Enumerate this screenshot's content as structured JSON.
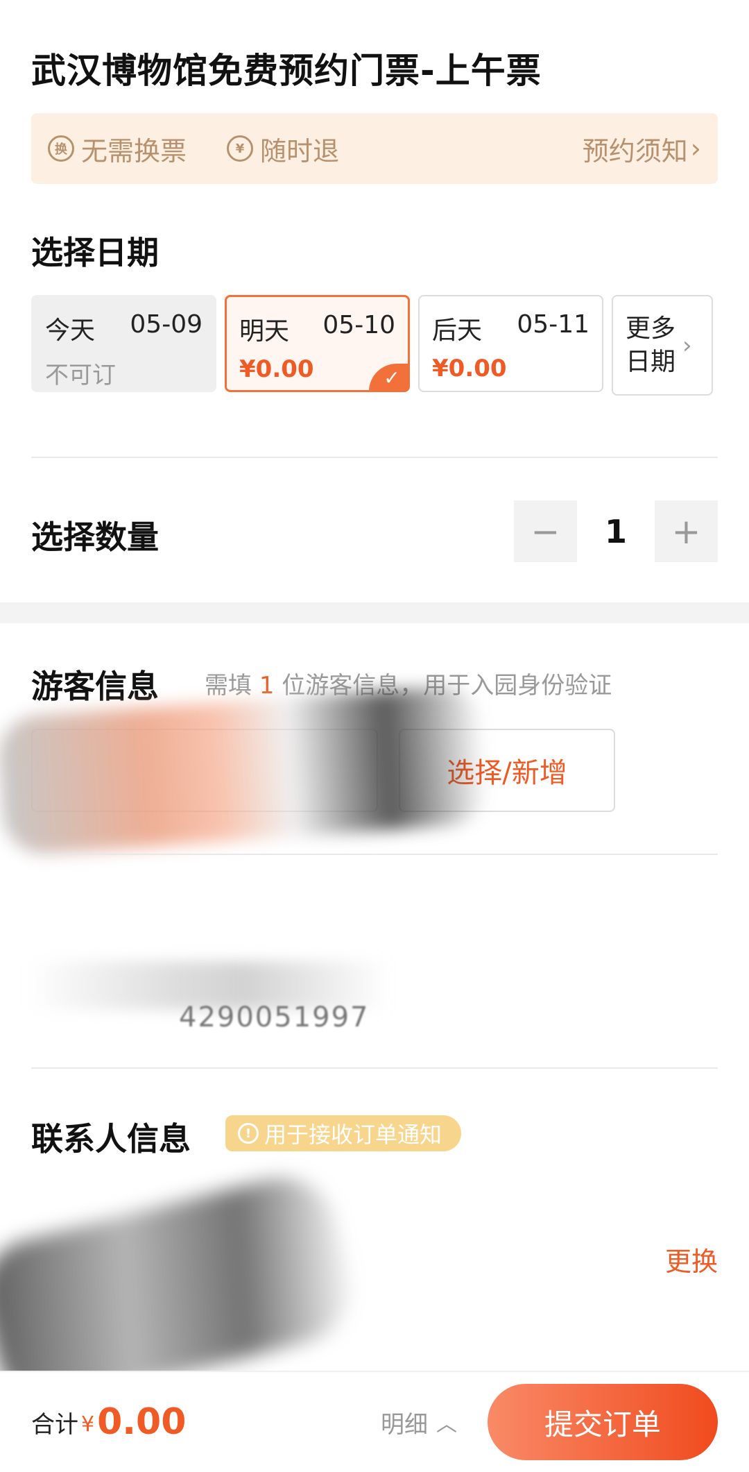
{
  "page": {
    "title": "武汉博物馆免费预约门票-上午票"
  },
  "notice": {
    "items": [
      {
        "icon": "exchange-icon",
        "icon_text": "换",
        "label": "无需换票"
      },
      {
        "icon": "yen-icon",
        "icon_text": "¥",
        "label": "随时退"
      }
    ],
    "link_label": "预约须知",
    "link_chevron": "›"
  },
  "date_section": {
    "title": "选择日期",
    "dates": [
      {
        "day": "今天",
        "date": "05-09",
        "status": "不可订",
        "state": "disabled"
      },
      {
        "day": "明天",
        "date": "05-10",
        "price": "¥0.00",
        "state": "selected"
      },
      {
        "day": "后天",
        "date": "05-11",
        "price": "¥0.00",
        "state": "available"
      }
    ],
    "more_line1": "更多",
    "more_line2": "日期",
    "more_chevron": "›",
    "check_mark": "✓"
  },
  "quantity_section": {
    "title": "选择数量",
    "minus": "−",
    "value": "1",
    "plus": "+"
  },
  "visitor_section": {
    "title": "游客信息",
    "hint_prefix": "需填",
    "hint_count": "1",
    "hint_suffix": "位游客信息，用于入园身份验证",
    "select_add_label": "选择/新增",
    "id_partial": "4290051997"
  },
  "contact_section": {
    "title": "联系人信息",
    "badge_icon": "!",
    "badge_label": "用于接收订单通知",
    "change_label": "更换"
  },
  "footer": {
    "total_label": "合计",
    "currency": "¥",
    "amount": "0.00",
    "detail_label": "明细",
    "detail_chevron": "︿",
    "submit_label": "提交订单"
  },
  "colors": {
    "accent": "#f05a24",
    "notice_bg": "#fdf0e3",
    "notice_text": "#b7916e",
    "badge_bg": "#f7d58d"
  }
}
